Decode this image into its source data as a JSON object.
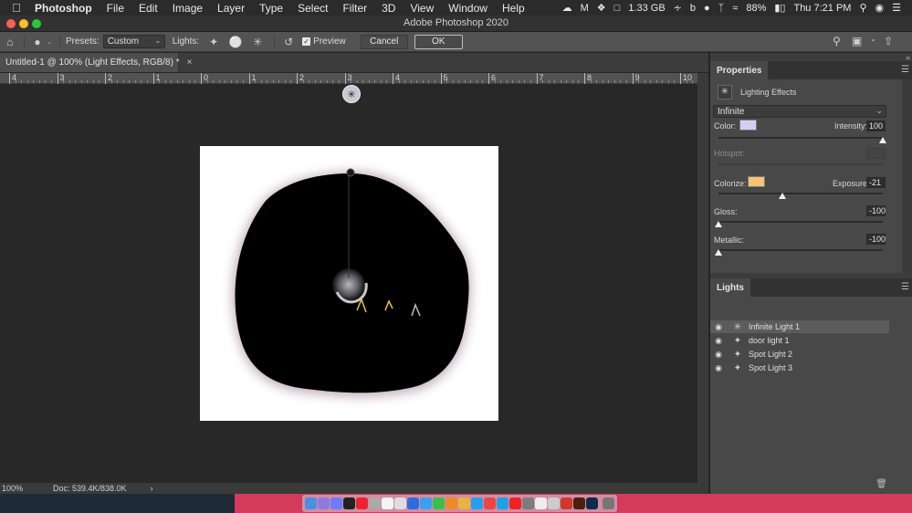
{
  "menubar": {
    "app_name": "Photoshop",
    "items": [
      "File",
      "Edit",
      "Image",
      "Layer",
      "Type",
      "Select",
      "Filter",
      "3D",
      "View",
      "Window",
      "Help"
    ],
    "memory": "1.33 GB",
    "battery": "88%",
    "clock": "Thu 7:21 PM"
  },
  "window": {
    "title": "Adobe Photoshop 2020"
  },
  "options": {
    "presets_label": "Presets:",
    "preset_value": "Custom",
    "lights_label": "Lights:",
    "preview_label": "Preview",
    "preview_checked": true,
    "cancel_label": "Cancel",
    "ok_label": "OK"
  },
  "document": {
    "tab_title": "Untitled-1 @ 100% (Light Effects, RGB/8) *",
    "zoom": "100%",
    "doc_info": "Doc: 539.4K/838.0K"
  },
  "ruler": {
    "labels": [
      "4",
      "3",
      "2",
      "1",
      "0",
      "1",
      "2",
      "3",
      "4",
      "5",
      "6",
      "7",
      "8",
      "9",
      "10"
    ]
  },
  "properties": {
    "tab_label": "Properties",
    "header": "Lighting Effects",
    "light_type": "Infinite",
    "color_label": "Color:",
    "color_value": "#d3cff2",
    "intensity_label": "Intensity:",
    "intensity_value": "100",
    "intensity_level": 1.0,
    "hotspot_label": "Hotspot:",
    "colorize_label": "Colorize:",
    "colorize_value": "#f6c374",
    "exposure_label": "Exposure:",
    "exposure_value": "-21",
    "exposure_level": 0.39,
    "gloss_label": "Gloss:",
    "gloss_value": "-100",
    "gloss_level": 0.0,
    "metallic_label": "Metallic:",
    "metallic_value": "-100",
    "metallic_level": 0.0
  },
  "lights_panel": {
    "tab_label": "Lights",
    "items": [
      {
        "name": "Infinite Light 1",
        "icon": "infinite-light-icon",
        "selected": true
      },
      {
        "name": "door light 1",
        "icon": "spot-light-icon",
        "selected": false
      },
      {
        "name": "Spot Light 2",
        "icon": "spot-light-icon",
        "selected": false
      },
      {
        "name": "Spot Light 3",
        "icon": "spot-light-icon",
        "selected": false
      }
    ]
  },
  "colors": {
    "dock_pink": "#d33b5b",
    "panel_bg": "#484848"
  }
}
